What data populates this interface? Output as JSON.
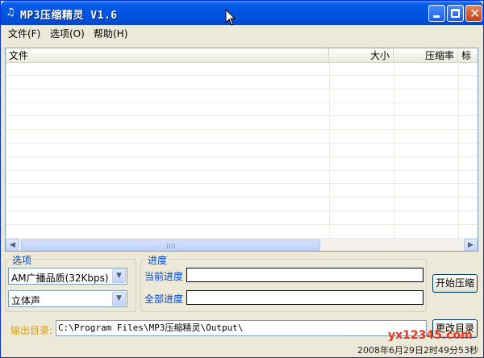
{
  "window": {
    "title": "MP3压缩精灵 V1.6",
    "app_icon": "music-note-icon"
  },
  "menu": [
    {
      "label": "文件(F)"
    },
    {
      "label": "选项(O)"
    },
    {
      "label": "帮助(H)"
    }
  ],
  "list": {
    "columns": [
      {
        "label": "文件",
        "align": "left"
      },
      {
        "label": "大小",
        "align": "right"
      },
      {
        "label": "压缩率",
        "align": "right"
      },
      {
        "label": "标",
        "align": "left"
      }
    ],
    "empty_rows": 13
  },
  "options_group": {
    "title": "选项",
    "quality": {
      "value": "AM广播品质(32Kbps)"
    },
    "channel": {
      "value": "立体声"
    }
  },
  "progress_group": {
    "title": "进度",
    "current_label": "当前进度",
    "total_label": "全部进度",
    "current_value": 0,
    "total_value": 0
  },
  "buttons": {
    "start": "开始压缩",
    "change_dir": "更改目录"
  },
  "output": {
    "label": "输出目录:",
    "path": "C:\\Program Files\\MP3压缩精灵\\Output\\"
  },
  "watermark": "yx12345.com",
  "status": {
    "time": "2008年6月29日2时49分53秒"
  },
  "colors": {
    "titlebar": "#0054e3",
    "group_title": "#0046d5",
    "output_label": "#d8a018",
    "watermark": "#e8341c"
  }
}
